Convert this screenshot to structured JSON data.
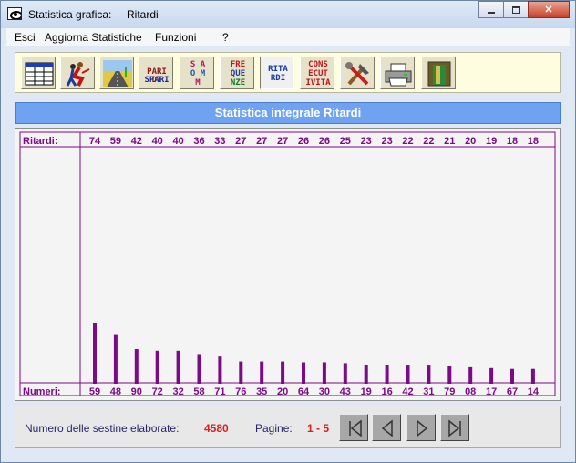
{
  "window": {
    "app_title": "Statistica grafica:",
    "subtitle": "Ritardi"
  },
  "menu": [
    "Esci",
    "Aggiorna Statistiche",
    "Funzioni",
    "?"
  ],
  "toolbar": {
    "buttons": [
      {
        "icon": "table-icon"
      },
      {
        "icon": "dancers-icon"
      },
      {
        "icon": "road-icon"
      },
      {
        "icon": "pari-dispari-icon",
        "text": [
          "PARI DI",
          "SPARI"
        ]
      },
      {
        "icon": "somme-icon",
        "text": [
          "S A",
          "O M",
          "M"
        ]
      },
      {
        "icon": "frequenze-icon",
        "text": [
          "FRE",
          "QUE",
          "NZE"
        ]
      },
      {
        "icon": "ritardi-icon",
        "text": [
          "RITA",
          "RDI"
        ],
        "active": true
      },
      {
        "icon": "consecutivita-icon",
        "text": [
          "CONS",
          "ECUT",
          "IVITA"
        ]
      },
      {
        "icon": "tools-icon"
      },
      {
        "icon": "printer-icon"
      },
      {
        "icon": "exit-door-icon"
      }
    ]
  },
  "header": {
    "title": "Statistica integrale Ritardi"
  },
  "chart_data": {
    "type": "bar",
    "top_row_label": "Ritardi:",
    "bottom_row_label": "Numeri:",
    "categories": [
      "59",
      "48",
      "90",
      "72",
      "32",
      "58",
      "71",
      "76",
      "35",
      "20",
      "64",
      "30",
      "43",
      "19",
      "16",
      "42",
      "31",
      "79",
      "08",
      "17",
      "67",
      "14"
    ],
    "values": [
      74,
      59,
      42,
      40,
      40,
      36,
      33,
      27,
      27,
      27,
      26,
      26,
      25,
      23,
      23,
      22,
      22,
      21,
      20,
      19,
      18,
      18
    ],
    "value_labels": [
      "74",
      "59",
      "42",
      "40",
      "40",
      "36",
      "33",
      "27",
      "27",
      "27",
      "26",
      "26",
      "25",
      "23",
      "23",
      "22",
      "22",
      "21",
      "20",
      "19",
      "18",
      "18"
    ],
    "bar_color": "#7b0a86",
    "label_color": "#7b0a86",
    "grid": false
  },
  "status": {
    "sestine_label": "Numero delle sestine elaborate:",
    "sestine_value": "4580",
    "pagine_label": "Pagine:",
    "pagine_value": "1 - 5"
  },
  "nav": [
    "first-page-icon",
    "prev-page-icon",
    "next-page-icon",
    "last-page-icon"
  ]
}
